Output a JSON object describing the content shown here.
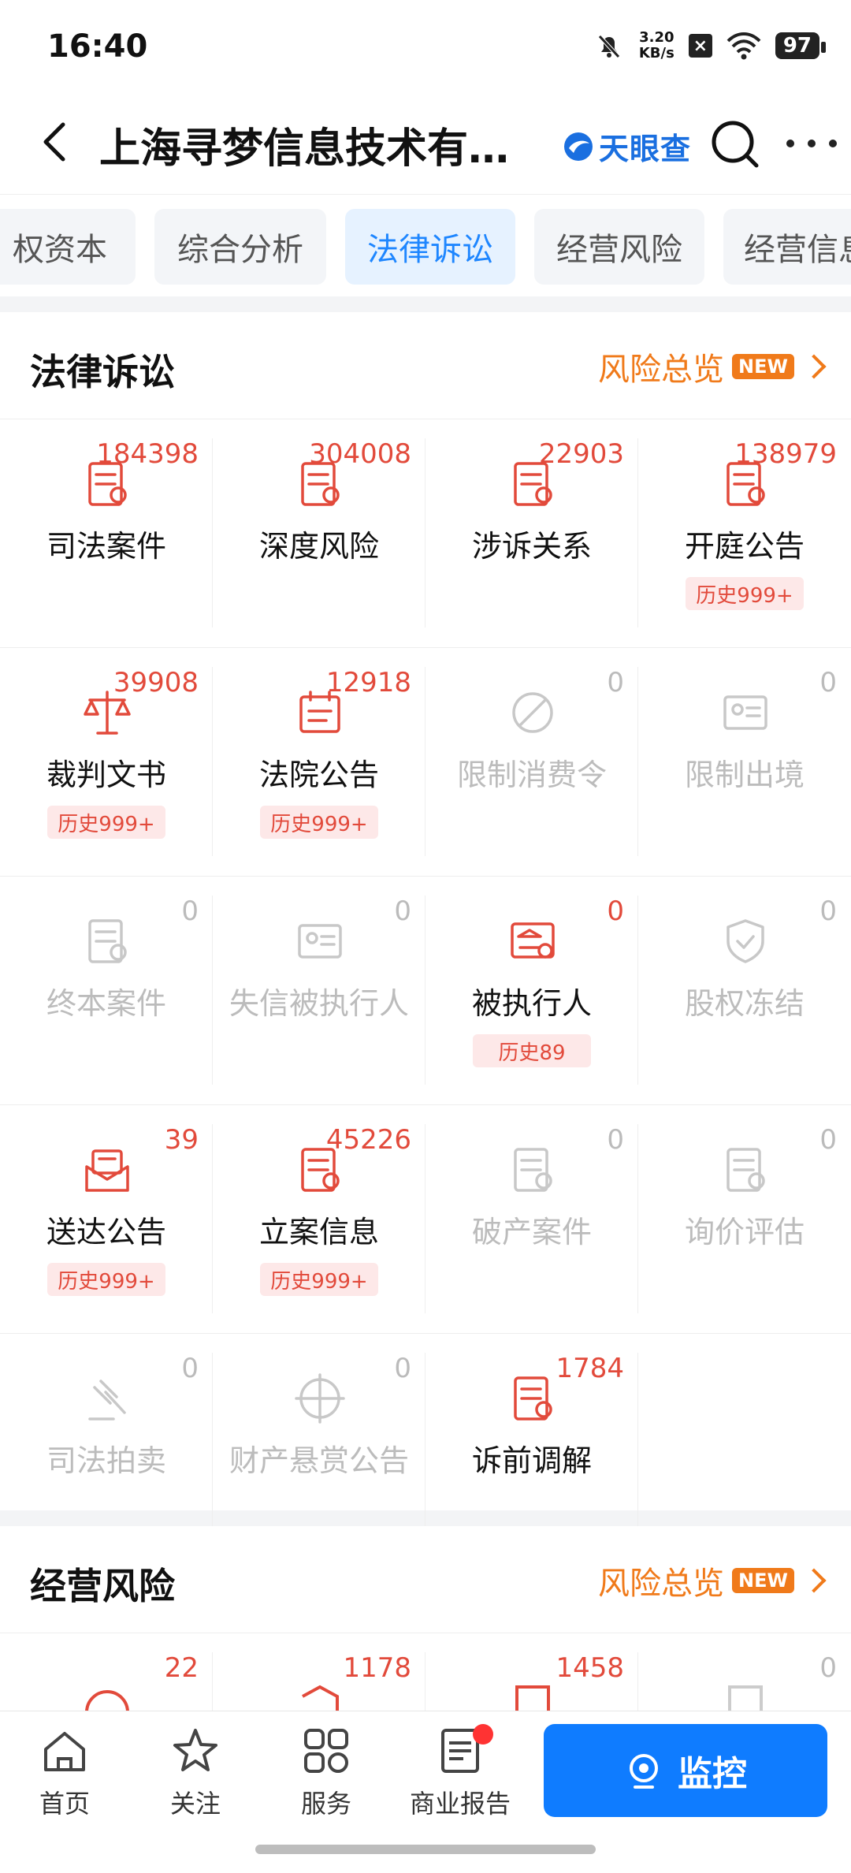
{
  "status": {
    "time": "16:40",
    "net_speed": "3.20\nKB/s",
    "battery": "97"
  },
  "header": {
    "title": "上海寻梦信息技术有…",
    "brand": "天眼查"
  },
  "tabs": [
    "权资本",
    "综合分析",
    "法律诉讼",
    "经营风险",
    "经营信息"
  ],
  "active_tab": "法律诉讼",
  "legal": {
    "title": "法律诉讼",
    "overview": "风险总览",
    "new": "NEW",
    "items": [
      {
        "label": "司法案件",
        "count": "184398",
        "icon": "case-search-icon",
        "active": true
      },
      {
        "label": "深度风险",
        "count": "304008",
        "icon": "risk-chart-icon",
        "active": true
      },
      {
        "label": "涉诉关系",
        "count": "22903",
        "icon": "relation-doc-icon",
        "active": true
      },
      {
        "label": "开庭公告",
        "count": "138979",
        "icon": "court-notice-icon",
        "active": true,
        "history": "历史999+"
      },
      {
        "label": "裁判文书",
        "count": "39908",
        "icon": "scale-icon",
        "active": true,
        "history": "历史999+"
      },
      {
        "label": "法院公告",
        "count": "12918",
        "icon": "court-calendar-icon",
        "active": true,
        "history": "历史999+"
      },
      {
        "label": "限制消费令",
        "count": "0",
        "icon": "restrict-consume-icon",
        "active": false
      },
      {
        "label": "限制出境",
        "count": "0",
        "icon": "restrict-exit-icon",
        "active": false
      },
      {
        "label": "终本案件",
        "count": "0",
        "icon": "final-case-icon",
        "active": false
      },
      {
        "label": "失信被执行人",
        "count": "0",
        "icon": "dishonest-person-icon",
        "active": false
      },
      {
        "label": "被执行人",
        "count": "0",
        "icon": "bank-search-icon",
        "active": true,
        "history": "历史89"
      },
      {
        "label": "股权冻结",
        "count": "0",
        "icon": "shield-icon",
        "active": false
      },
      {
        "label": "送达公告",
        "count": "39",
        "icon": "mail-notice-icon",
        "active": true,
        "history": "历史999+"
      },
      {
        "label": "立案信息",
        "count": "45226",
        "icon": "filing-doc-icon",
        "active": true,
        "history": "历史999+"
      },
      {
        "label": "破产案件",
        "count": "0",
        "icon": "bankruptcy-icon",
        "active": false
      },
      {
        "label": "询价评估",
        "count": "0",
        "icon": "price-eval-icon",
        "active": false
      },
      {
        "label": "司法拍卖",
        "count": "0",
        "icon": "auction-hammer-icon",
        "active": false
      },
      {
        "label": "财产悬赏公告",
        "count": "0",
        "icon": "property-reward-icon",
        "active": false
      },
      {
        "label": "诉前调解",
        "count": "1784",
        "icon": "mediation-icon",
        "active": true
      }
    ]
  },
  "business": {
    "title": "经营风险",
    "overview": "风险总览",
    "new": "NEW",
    "counts": [
      "22",
      "1178",
      "1458",
      "0"
    ]
  },
  "nav": {
    "home": "首页",
    "follow": "关注",
    "service": "服务",
    "report": "商业报告",
    "monitor": "监控"
  },
  "colors": {
    "accent": "#1e86ff",
    "red": "#e24a3b",
    "orange": "#f07a1a",
    "gray": "#bcbcbc"
  }
}
